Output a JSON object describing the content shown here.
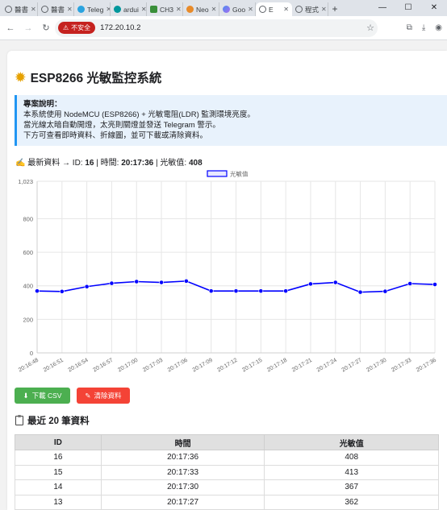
{
  "browser": {
    "tabs": [
      {
        "title": "醫書",
        "icon": "globe"
      },
      {
        "title": "醫書",
        "icon": "globe"
      },
      {
        "title": "Teleg",
        "icon": "tg"
      },
      {
        "title": "ardui",
        "icon": "ard"
      },
      {
        "title": "CH3",
        "icon": "ch3"
      },
      {
        "title": "Neo",
        "icon": "neo"
      },
      {
        "title": "Goo",
        "icon": "gem"
      },
      {
        "title": "E",
        "icon": "globe",
        "active": true
      },
      {
        "title": "程式",
        "icon": "globe"
      }
    ],
    "insecure_label": "不安全",
    "url": "172.20.10.2"
  },
  "page": {
    "title": "ESP8266 光敏監控系統",
    "desc_heading": "專案說明：",
    "desc_lines": [
      "本系統使用 NodeMCU (ESP8266) + 光敏電阻(LDR) 監測環境亮度。",
      "當光線太暗自動開燈，太亮則關燈並發送 Telegram 警示。",
      "下方可查看即時資料、折線圖，並可下載或清除資料。"
    ],
    "latest": {
      "prefix": "最新資料 → ID: ",
      "id": "16",
      "time_label": " | 時間: ",
      "time": "20:17:36",
      "value_label": " | 光敏值: ",
      "value": "408"
    },
    "buttons": {
      "csv": "下載 CSV",
      "clear": "清除資料"
    },
    "table_title": "最近 20 筆資料",
    "table": {
      "headers": [
        "ID",
        "時間",
        "光敏值"
      ],
      "rows": [
        [
          "16",
          "20:17:36",
          "408"
        ],
        [
          "15",
          "20:17:33",
          "413"
        ],
        [
          "14",
          "20:17:30",
          "367"
        ],
        [
          "13",
          "20:17:27",
          "362"
        ]
      ]
    }
  },
  "chart_data": {
    "type": "line",
    "categories": [
      "20:16:48",
      "20:16:51",
      "20:16:54",
      "20:16:57",
      "20:17:00",
      "20:17:03",
      "20:17:06",
      "20:17:09",
      "20:17:12",
      "20:17:15",
      "20:17:18",
      "20:17:21",
      "20:17:24",
      "20:17:27",
      "20:17:30",
      "20:17:33",
      "20:17:36"
    ],
    "series": [
      {
        "name": "光敏值",
        "values": [
          369,
          366,
          395,
          415,
          425,
          420,
          428,
          369,
          369,
          369,
          369,
          411,
          420,
          362,
          367,
          413,
          408
        ],
        "color": "#0000ff"
      }
    ],
    "yticks": [
      "0",
      "200",
      "400",
      "600",
      "800",
      "1,023"
    ],
    "ylim": [
      0,
      1023
    ],
    "grid": true,
    "legend": "top-center"
  }
}
